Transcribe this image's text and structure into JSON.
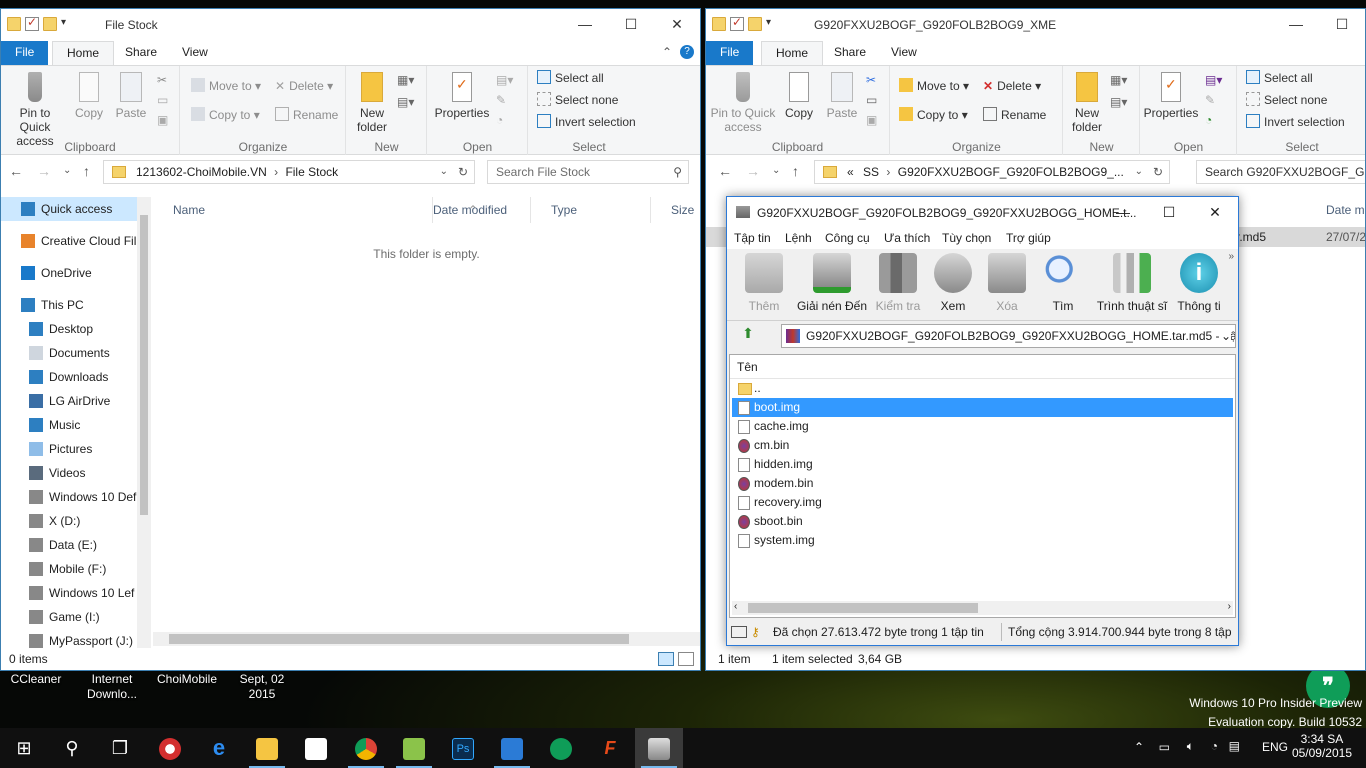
{
  "desktop": {
    "icons": [
      "CCleaner",
      "Internet Downlo...",
      "ChoiMobile",
      "Sept, 02 2015"
    ],
    "watermark_line1": "Windows 10 Pro Insider Preview",
    "watermark_line2": "Evaluation copy. Build 10532"
  },
  "left_window": {
    "title": "File Stock",
    "tabs": {
      "file": "File",
      "home": "Home",
      "share": "Share",
      "view": "View"
    },
    "ribbon": {
      "pin": "Pin to Quick access",
      "copy": "Copy",
      "paste": "Paste",
      "clipboard": "Clipboard",
      "move_to": "Move to",
      "copy_to": "Copy to",
      "delete": "Delete",
      "rename": "Rename",
      "organize": "Organize",
      "new_folder": "New folder",
      "new": "New",
      "properties": "Properties",
      "open": "Open",
      "select_all": "Select all",
      "select_none": "Select none",
      "invert_selection": "Invert selection",
      "select": "Select"
    },
    "address": {
      "crumb1": "1213602-ChoiMobile.VN",
      "sep": "›",
      "crumb2": "File Stock"
    },
    "search_placeholder": "Search File Stock",
    "nav": [
      "Quick access",
      "Creative Cloud Fil",
      "OneDrive",
      "This PC",
      "Desktop",
      "Documents",
      "Downloads",
      "LG AirDrive",
      "Music",
      "Pictures",
      "Videos",
      "Windows 10 Def",
      "X (D:)",
      "Data (E:)",
      "Mobile (F:)",
      "Windows 10 Lef",
      "Game (I:)",
      "MyPassport (J:)"
    ],
    "columns": {
      "name": "Name",
      "date": "Date modified",
      "type": "Type",
      "size": "Size"
    },
    "empty_text": "This folder is empty.",
    "status": "0 items"
  },
  "right_window": {
    "title": "G920FXXU2BOGF_G920FOLB2BOG9_XME",
    "tabs": {
      "file": "File",
      "home": "Home",
      "share": "Share",
      "view": "View"
    },
    "address": {
      "lead": "«",
      "crumb1": "SS",
      "sep": "›",
      "crumb2": "G920FXXU2BOGF_G920FOLB2BOG9_..."
    },
    "search_placeholder": "Search G920FXXU2BOGF_G92...",
    "date_header": "Date mo",
    "row_tail_name": "tar.md5",
    "row_tail_date": "27/07/2",
    "status_items": "1 item",
    "status_selected": "1 item selected",
    "status_size": "3,64 GB"
  },
  "winrar": {
    "title": "G920FXXU2BOGF_G920FOLB2BOG9_G920FXXU2BOGG_HOME.t...",
    "menu": [
      "Tập tin",
      "Lệnh",
      "Công cụ",
      "Ưa thích",
      "Tùy chọn",
      "Trợ giúp"
    ],
    "tools": [
      "Thêm",
      "Giải nén Đến",
      "Kiểm tra",
      "Xem",
      "Xóa",
      "Tìm",
      "Trình thuật sĩ",
      "Thông ti"
    ],
    "path": "G920FXXU2BOGF_G920FOLB2BOG9_G920FXXU2BOGG_HOME.tar.md5 - Tập tin",
    "column_name": "Tên",
    "files": [
      "..",
      "boot.img",
      "cache.img",
      "cm.bin",
      "hidden.img",
      "modem.bin",
      "recovery.img",
      "sboot.bin",
      "system.img"
    ],
    "selected": "boot.img",
    "status_left": "Đã chọn 27.613.472 byte trong 1 tập tin",
    "status_right": "Tổng cộng 3.914.700.944 byte trong 8 tập"
  },
  "taskbar": {
    "language": "ENG",
    "time": "3:34 SA",
    "date": "05/09/2015"
  },
  "colors": {
    "accent": "#1979ca",
    "selection": "#3399ff",
    "nav_selected": "#cce8ff"
  }
}
